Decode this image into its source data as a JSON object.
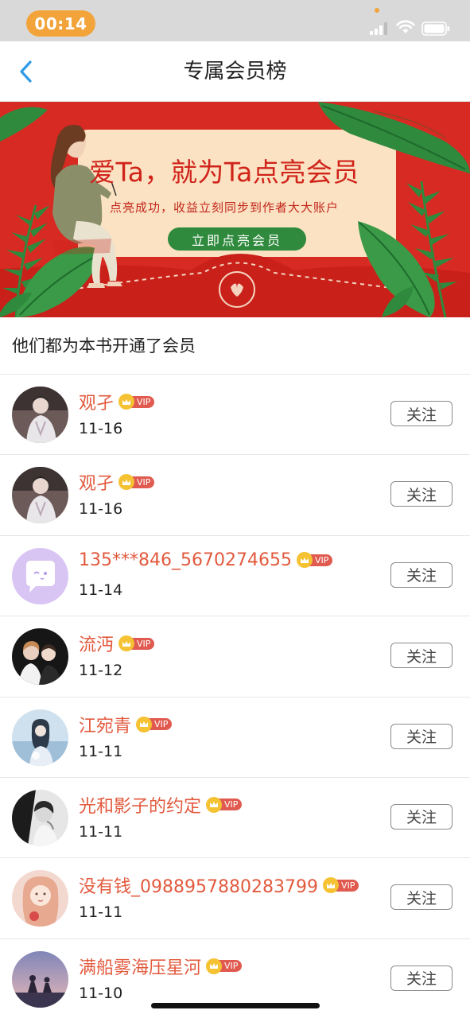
{
  "status_bar": {
    "time": "00:14"
  },
  "nav": {
    "title": "专属会员榜"
  },
  "banner": {
    "headline": "爱Ta，就为Ta点亮会员",
    "subtext": "点亮成功，收益立刻同步到作者大大账户",
    "cta_label": "立即点亮会员"
  },
  "section": {
    "heading": "他们都为本书开通了会员"
  },
  "members": [
    {
      "name": "观孑",
      "date": "11-16",
      "badge": "VIP",
      "follow_label": "关注",
      "avatar": "photo-avatar"
    },
    {
      "name": "观孑",
      "date": "11-16",
      "badge": "VIP",
      "follow_label": "关注",
      "avatar": "photo-avatar"
    },
    {
      "name": "135***846_5670274655",
      "date": "11-14",
      "badge": "VIP",
      "follow_label": "关注",
      "avatar": "default-avatar"
    },
    {
      "name": "流沔",
      "date": "11-12",
      "badge": "VIP",
      "follow_label": "关注",
      "avatar": "photo-avatar"
    },
    {
      "name": "江宛青",
      "date": "11-11",
      "badge": "VIP",
      "follow_label": "关注",
      "avatar": "photo-avatar"
    },
    {
      "name": "光和影子的约定",
      "date": "11-11",
      "badge": "VIP",
      "follow_label": "关注",
      "avatar": "photo-avatar"
    },
    {
      "name": "没有钱_0988957880283799",
      "date": "11-11",
      "badge": "VIP",
      "follow_label": "关注",
      "avatar": "photo-avatar"
    },
    {
      "name": "满船雾海压星河",
      "date": "11-10",
      "badge": "VIP",
      "follow_label": "关注",
      "avatar": "photo-avatar"
    }
  ],
  "colors": {
    "accent": "#e25a3e",
    "banner_red": "#d72a23",
    "time_pill": "#f2a43a",
    "cta_green": "#2f8a3d",
    "vip_gold": "#f4c233",
    "vip_red": "#e05a50"
  }
}
